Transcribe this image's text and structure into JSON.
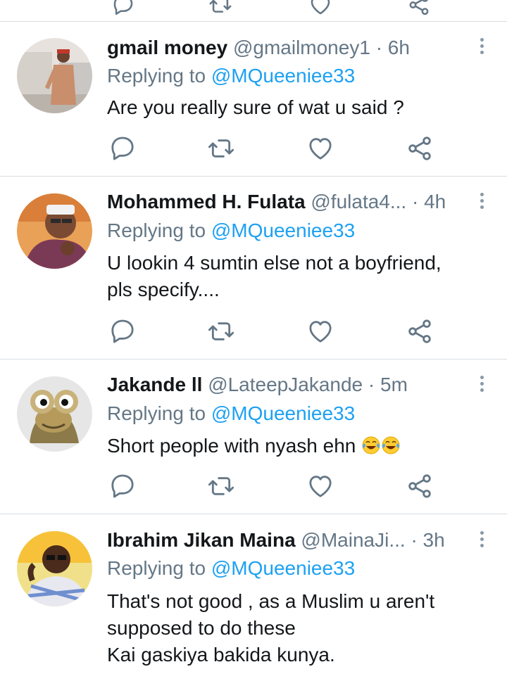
{
  "tweets": [
    {
      "name": "gmail money",
      "handle": "@gmailmoney1",
      "time": "· 6h",
      "replying_prefix": "Replying to",
      "replying_to": "@MQueeniee33",
      "text_lines": [
        "Are you really sure of wat u said ?"
      ]
    },
    {
      "name": "Mohammed H. Fulata",
      "handle": "@fulata4...",
      "time": "· 4h",
      "replying_prefix": "Replying to",
      "replying_to": "@MQueeniee33",
      "text_lines": [
        "U lookin 4 sumtin else not a boyfriend,",
        "pls specify...."
      ]
    },
    {
      "name": "Jakande ll",
      "handle": "@LateepJakande",
      "time": "· 5m",
      "replying_prefix": "Replying to",
      "replying_to": "@MQueeniee33",
      "text_lines": [
        "Short people with nyash ehn"
      ],
      "emojis": [
        "face-with-tears-of-joy",
        "face-with-tears-of-joy"
      ]
    },
    {
      "name": "Ibrahim Jikan Maina",
      "handle": "@MainaJi...",
      "time": "· 3h",
      "replying_prefix": "Replying to",
      "replying_to": "@MQueeniee33",
      "text_lines": [
        "That's not good , as a Muslim u aren't",
        "supposed to do these",
        "Kai gaskiya bakida kunya."
      ]
    }
  ],
  "action_icons": [
    "reply-icon",
    "retweet-icon",
    "like-icon",
    "share-icon"
  ],
  "colors": {
    "name": "#14171a",
    "handle": "#657786",
    "mention": "#1da1f2",
    "icon": "#657786",
    "divider": "#d8dde1"
  }
}
